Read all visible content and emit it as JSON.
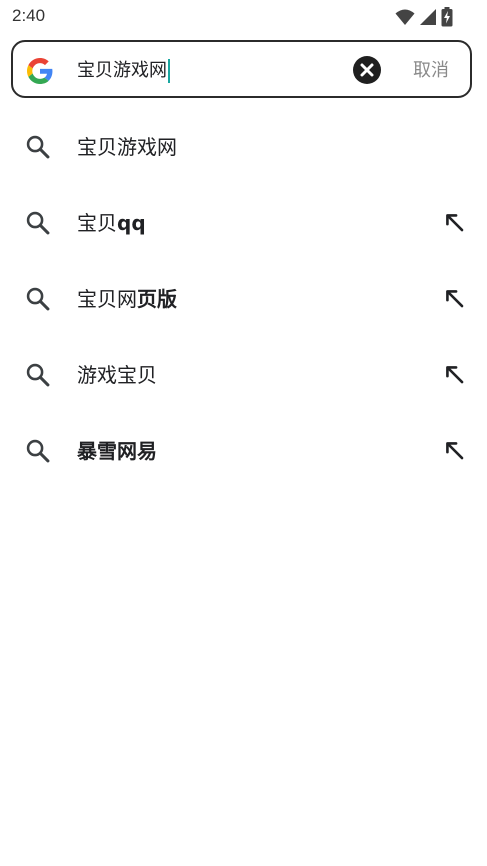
{
  "status_bar": {
    "time": "2:40",
    "icons": [
      "wifi-icon",
      "cellular-signal-icon",
      "battery-charging-icon"
    ]
  },
  "search": {
    "value": "宝贝游戏网",
    "cancel_label": "取消",
    "icons": [
      "google-logo-icon",
      "clear-icon"
    ]
  },
  "suggestions": [
    {
      "normal": "宝贝游戏网",
      "bold": "",
      "has_fill_arrow": false
    },
    {
      "normal": "宝贝",
      "bold": "qq",
      "has_fill_arrow": true
    },
    {
      "normal": "宝贝网",
      "bold": "页版",
      "has_fill_arrow": true
    },
    {
      "normal": "游戏宝贝",
      "bold": "",
      "has_fill_arrow": true
    },
    {
      "normal": "",
      "bold": "暴雪网易",
      "has_fill_arrow": true
    }
  ],
  "colors": {
    "caret": "#1aa7a1",
    "cancel": "#8a8a8a",
    "text": "#202124",
    "icon": "#3c4043"
  }
}
